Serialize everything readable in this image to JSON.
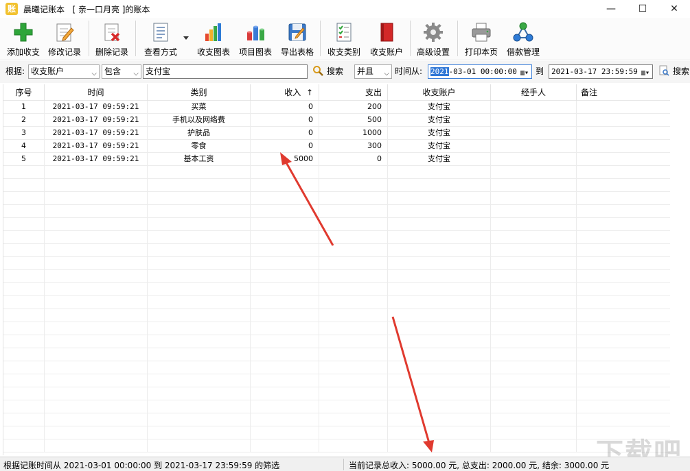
{
  "window": {
    "app_icon_char": "账",
    "title": "晨曦记账本   [ 亲一口月亮 ]的账本",
    "min": "—",
    "max": "☐",
    "close": "✕"
  },
  "toolbar": {
    "add": "添加收支",
    "edit": "修改记录",
    "delete": "删除记录",
    "view": "查看方式",
    "chart_income": "收支图表",
    "chart_project": "项目图表",
    "export": "导出表格",
    "category": "收支类别",
    "account": "收支账户",
    "settings": "高级设置",
    "print": "打印本页",
    "loan": "借款管理"
  },
  "filter": {
    "by_label": "根据:",
    "field_value": "收支账户",
    "op_value": "包含",
    "keyword_value": "支付宝",
    "search1": "搜索",
    "logic_value": "并且",
    "time_from_label": "时间从:",
    "from_date_sel": "2021",
    "from_date_rest": "-03-01 00:00:00",
    "to_label": "到",
    "to_date": "2021-03-17 23:59:59",
    "search2": "搜索"
  },
  "table": {
    "columns": {
      "seq": "序号",
      "time": "时间",
      "category": "类别",
      "income": "收入",
      "sort_indicator": "↑",
      "expense": "支出",
      "account": "收支账户",
      "handler": "经手人",
      "note": "备注"
    },
    "rows": [
      {
        "seq": "1",
        "time": "2021-03-17 09:59:21",
        "category": "买菜",
        "income": "0",
        "expense": "200",
        "account": "支付宝",
        "handler": "",
        "note": ""
      },
      {
        "seq": "2",
        "time": "2021-03-17 09:59:21",
        "category": "手机以及网络费",
        "income": "0",
        "expense": "500",
        "account": "支付宝",
        "handler": "",
        "note": ""
      },
      {
        "seq": "3",
        "time": "2021-03-17 09:59:21",
        "category": "护肤品",
        "income": "0",
        "expense": "1000",
        "account": "支付宝",
        "handler": "",
        "note": ""
      },
      {
        "seq": "4",
        "time": "2021-03-17 09:59:21",
        "category": "零食",
        "income": "0",
        "expense": "300",
        "account": "支付宝",
        "handler": "",
        "note": ""
      },
      {
        "seq": "5",
        "time": "2021-03-17 09:59:21",
        "category": "基本工资",
        "income": "5000",
        "expense": "0",
        "account": "支付宝",
        "handler": "",
        "note": ""
      }
    ]
  },
  "status": {
    "left": "根据记账时间从 2021-03-01 00:00:00 到 2021-03-17 23:59:59 的筛选",
    "right": "当前记录总收入: 5000.00 元, 总支出: 2000.00 元, 结余: 3000.00 元"
  },
  "watermark": "下载吧",
  "colors": {
    "accent_blue": "#3178d6",
    "annotation_red": "#e03a2f"
  }
}
